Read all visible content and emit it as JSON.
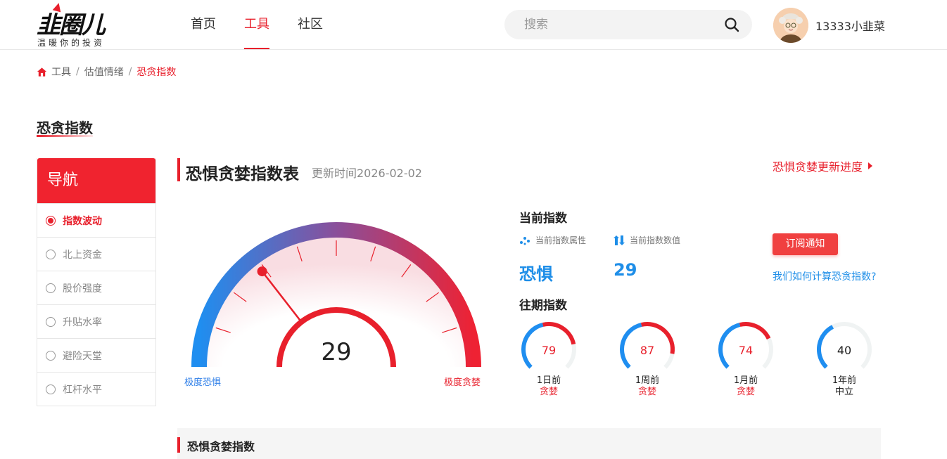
{
  "header": {
    "logo_text": "韭圈儿",
    "logo_slogan": "温暖你的投资",
    "nav": [
      {
        "label": "首页",
        "active": false
      },
      {
        "label": "工具",
        "active": true
      },
      {
        "label": "社区",
        "active": false
      }
    ],
    "search_placeholder": "搜索",
    "username": "13333小韭菜"
  },
  "breadcrumb": [
    "工具",
    "估值情绪",
    "恐贪指数"
  ],
  "page_title": "恐贪指数",
  "sidebar": {
    "title": "导航",
    "items": [
      {
        "label": "指数波动",
        "active": true
      },
      {
        "label": "北上资金",
        "active": false
      },
      {
        "label": "股价强度",
        "active": false
      },
      {
        "label": "升贴水率",
        "active": false
      },
      {
        "label": "避险天堂",
        "active": false
      },
      {
        "label": "杠杆水平",
        "active": false
      }
    ]
  },
  "section": {
    "title": "恐惧贪婪指数表",
    "update_time": "更新时间2026-02-02",
    "progress_link": "恐惧贪婪更新进度"
  },
  "gauge": {
    "value": 29,
    "min": 0,
    "max": 100,
    "label_left": "极度恐惧",
    "label_right": "极度贪婪"
  },
  "current": {
    "title": "当前指数",
    "attr_label": "当前指数属性",
    "value_label": "当前指数数值",
    "attr_value": "恐惧",
    "value": "29",
    "subscribe_label": "订阅通知",
    "how_link": "我们如何计算恐贪指数?"
  },
  "history": {
    "title": "往期指数",
    "items": [
      {
        "value": 79,
        "when": "1日前",
        "state": "贪婪",
        "color": "#e8202c"
      },
      {
        "value": 87,
        "when": "1周前",
        "state": "贪婪",
        "color": "#e8202c"
      },
      {
        "value": 74,
        "when": "1月前",
        "state": "贪婪",
        "color": "#e8202c"
      },
      {
        "value": 40,
        "when": "1年前",
        "state": "中立",
        "color": "#222222"
      }
    ]
  },
  "bottom_section_title": "恐惧贪婪指数",
  "colors": {
    "accent": "#e8202c",
    "blue": "#1e8ee8"
  }
}
